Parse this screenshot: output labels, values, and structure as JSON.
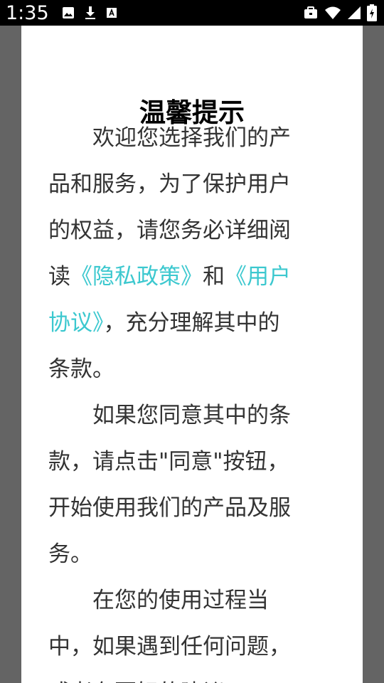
{
  "status_bar": {
    "time": "1:35",
    "icons_left": [
      "image-icon",
      "download-icon",
      "font-icon"
    ],
    "icons_right": [
      "briefcase-icon",
      "wifi-icon",
      "signal-icon",
      "battery-icon"
    ]
  },
  "dialog": {
    "title": "温馨提示",
    "paragraph1": {
      "line1": "欢迎您选择我们的产",
      "line2": "品和服务，为了保护用户",
      "line3": "的权益，请您务必详细阅",
      "line4_prefix": "读",
      "privacy_link": "《隐私政策》",
      "line4_middle": "和",
      "user_agreement_link_part1": "《用户",
      "user_agreement_link_part2": "协议》",
      "line5_suffix": "，充分理解其中的",
      "line6": "条款。"
    },
    "paragraph2": {
      "line1": "如果您同意其中的条",
      "line2": "款，请点击\"同意\"按钮，",
      "line3": "开始使用我们的产品及服",
      "line4": "务。"
    },
    "paragraph3": {
      "line1": "在您的使用过程当",
      "line2": "中，如果遇到任何问题，",
      "line3": "或者有更好的建议"
    }
  },
  "colors": {
    "link": "#3cc8cf",
    "overlay": "#646464",
    "text": "#333333"
  }
}
